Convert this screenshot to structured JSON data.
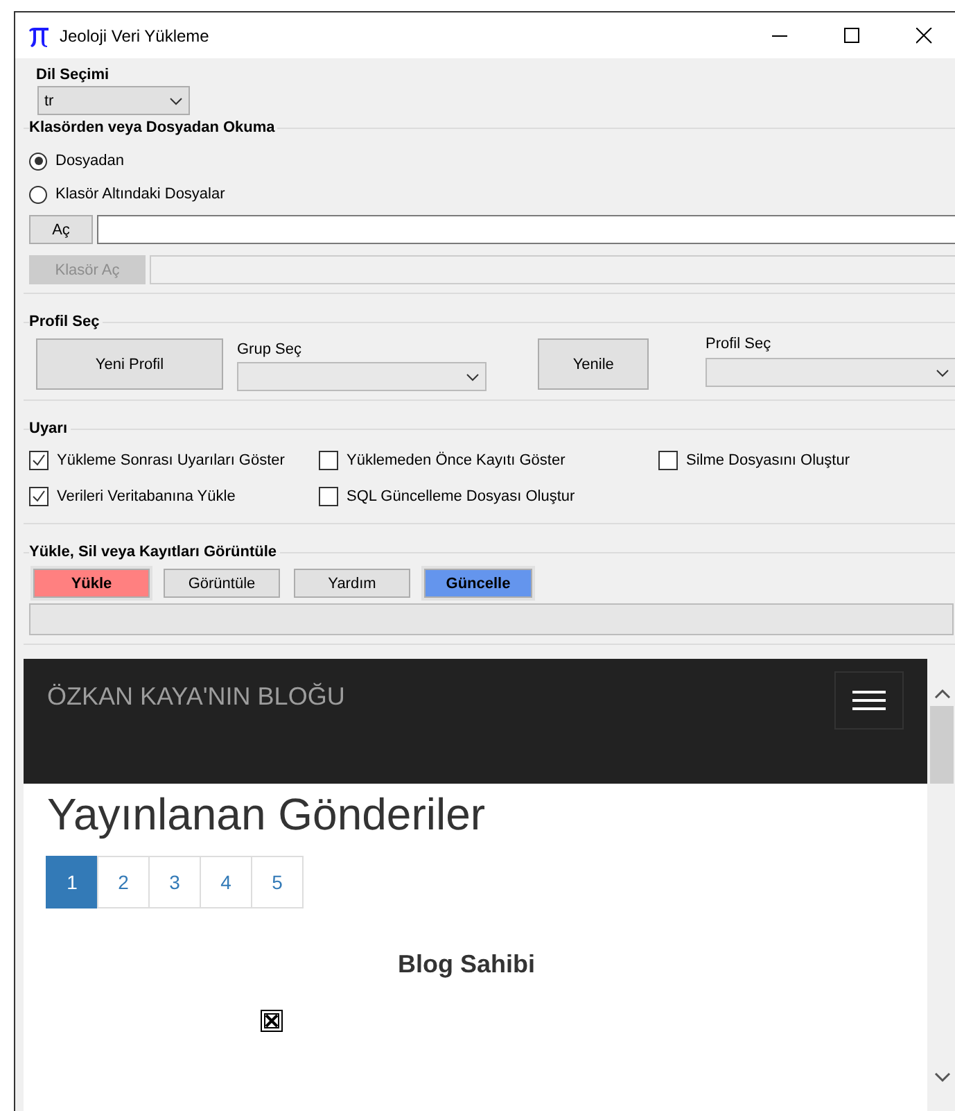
{
  "window": {
    "title": "Jeoloji Veri Yükleme"
  },
  "language": {
    "label": "Dil Seçimi",
    "value": "tr"
  },
  "source_group": {
    "title": "Klasörden veya Dosyadan Okuma",
    "options": [
      {
        "label": "Dosyadan",
        "selected": true
      },
      {
        "label": "Klasör Altındaki Dosyalar",
        "selected": false
      }
    ],
    "rows": [
      {
        "button": "Aç",
        "disabled": false
      },
      {
        "button": "Klasör Aç",
        "disabled": true
      }
    ]
  },
  "profile_group": {
    "title": "Profil Seç",
    "new_button": "Yeni Profil",
    "group_label": "Grup Seç",
    "refresh_button": "Yenile",
    "profile_label": "Profil Seç"
  },
  "warn_group": {
    "title": "Uyarı",
    "checkboxes": [
      {
        "label": "Yükleme Sonrası Uyarıları Göster",
        "checked": true
      },
      {
        "label": "Verileri Veritabanına Yükle",
        "checked": true
      },
      {
        "label": "Yüklemeden Önce Kayıtı Göster",
        "checked": false
      },
      {
        "label": "SQL Güncelleme Dosyası Oluştur",
        "checked": false
      },
      {
        "label": "Silme Dosyasını Oluştur",
        "checked": false
      }
    ]
  },
  "action_group": {
    "title": "Yükle, Sil veya Kayıtları Görüntüle",
    "buttons": [
      {
        "label": "Yükle",
        "color": "#ff8080"
      },
      {
        "label": "Görüntüle"
      },
      {
        "label": "Yardım"
      },
      {
        "label": "Güncelle",
        "color": "#6495ed"
      }
    ]
  },
  "browser": {
    "brand": "ÖZKAN KAYA'NIN BLOĞU",
    "heading": "Yayınlanan Gönderiler",
    "pages": [
      {
        "label": "1",
        "selected": true
      },
      {
        "label": "2",
        "selected": false
      },
      {
        "label": "3",
        "selected": false
      },
      {
        "label": "4",
        "selected": false
      },
      {
        "label": "5",
        "selected": false
      }
    ],
    "sidebar_title": "Blog Sahibi"
  }
}
